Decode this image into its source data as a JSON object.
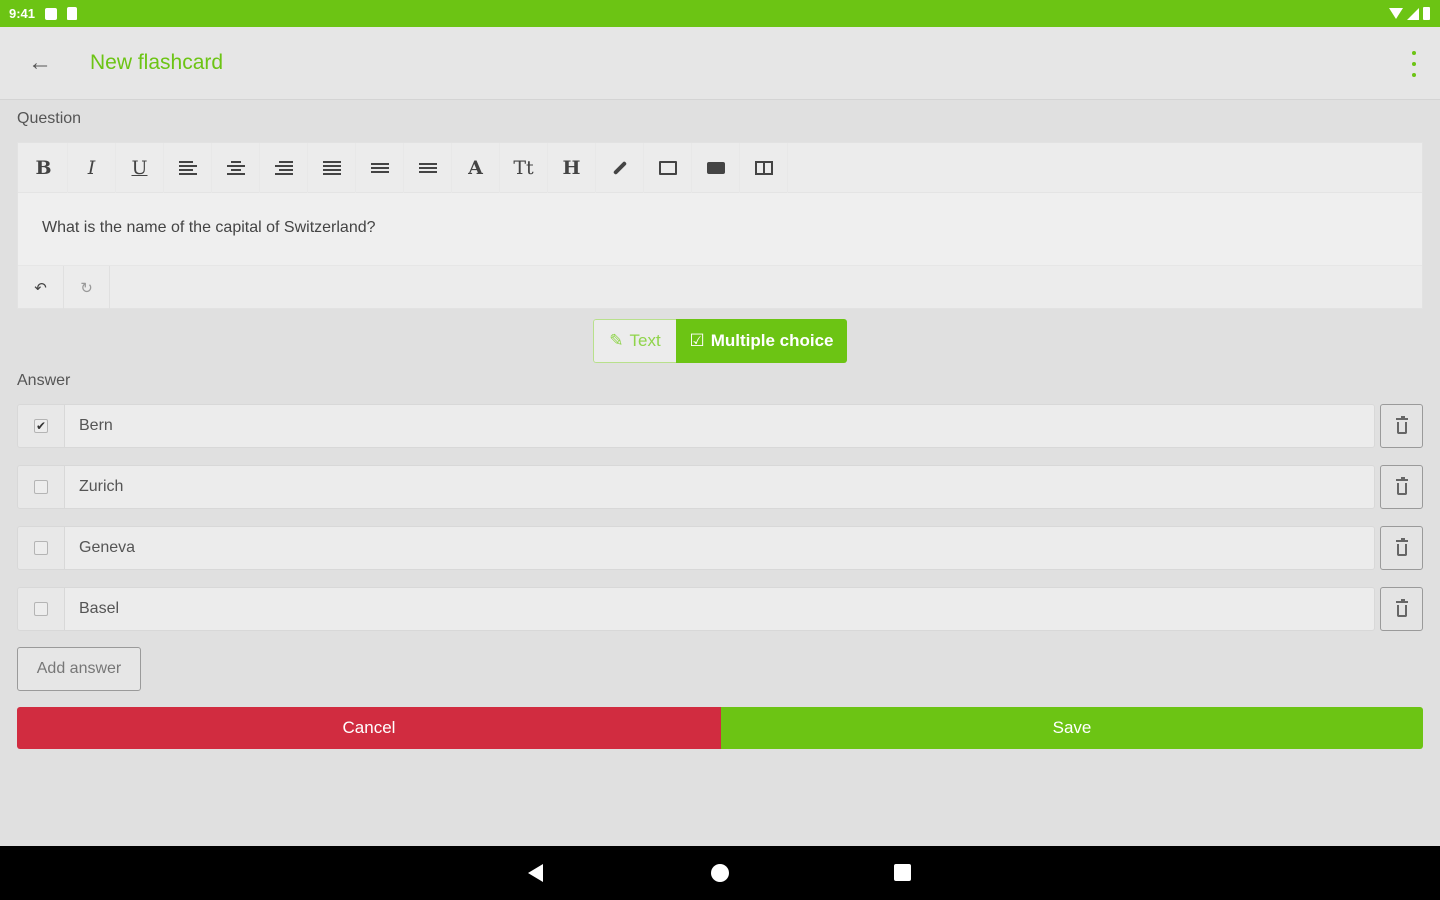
{
  "status_bar": {
    "time": "9:41"
  },
  "app_bar": {
    "back_icon": "arrow-left-icon",
    "title": "New flashcard",
    "more_icon": "more-vert-icon"
  },
  "question": {
    "label": "Question",
    "toolbar": {
      "bold": "B",
      "italic": "I",
      "underline": "U",
      "font": "A",
      "text_size": "Tt",
      "heading": "H"
    },
    "text": "What is the name of the capital of Switzerland?",
    "undo_icon": "undo-icon",
    "redo_icon": "redo-icon"
  },
  "mode": {
    "text_label": "Text",
    "multiple_choice_label": "Multiple choice",
    "selected": "Multiple choice"
  },
  "answer": {
    "label": "Answer",
    "items": [
      {
        "value": "Bern",
        "checked": true
      },
      {
        "value": "Zurich",
        "checked": false
      },
      {
        "value": "Geneva",
        "checked": false
      },
      {
        "value": "Basel",
        "checked": false
      }
    ],
    "add_label": "Add answer"
  },
  "actions": {
    "cancel_label": "Cancel",
    "save_label": "Save"
  },
  "colors": {
    "accent": "#6cc414",
    "danger": "#d12c40"
  }
}
